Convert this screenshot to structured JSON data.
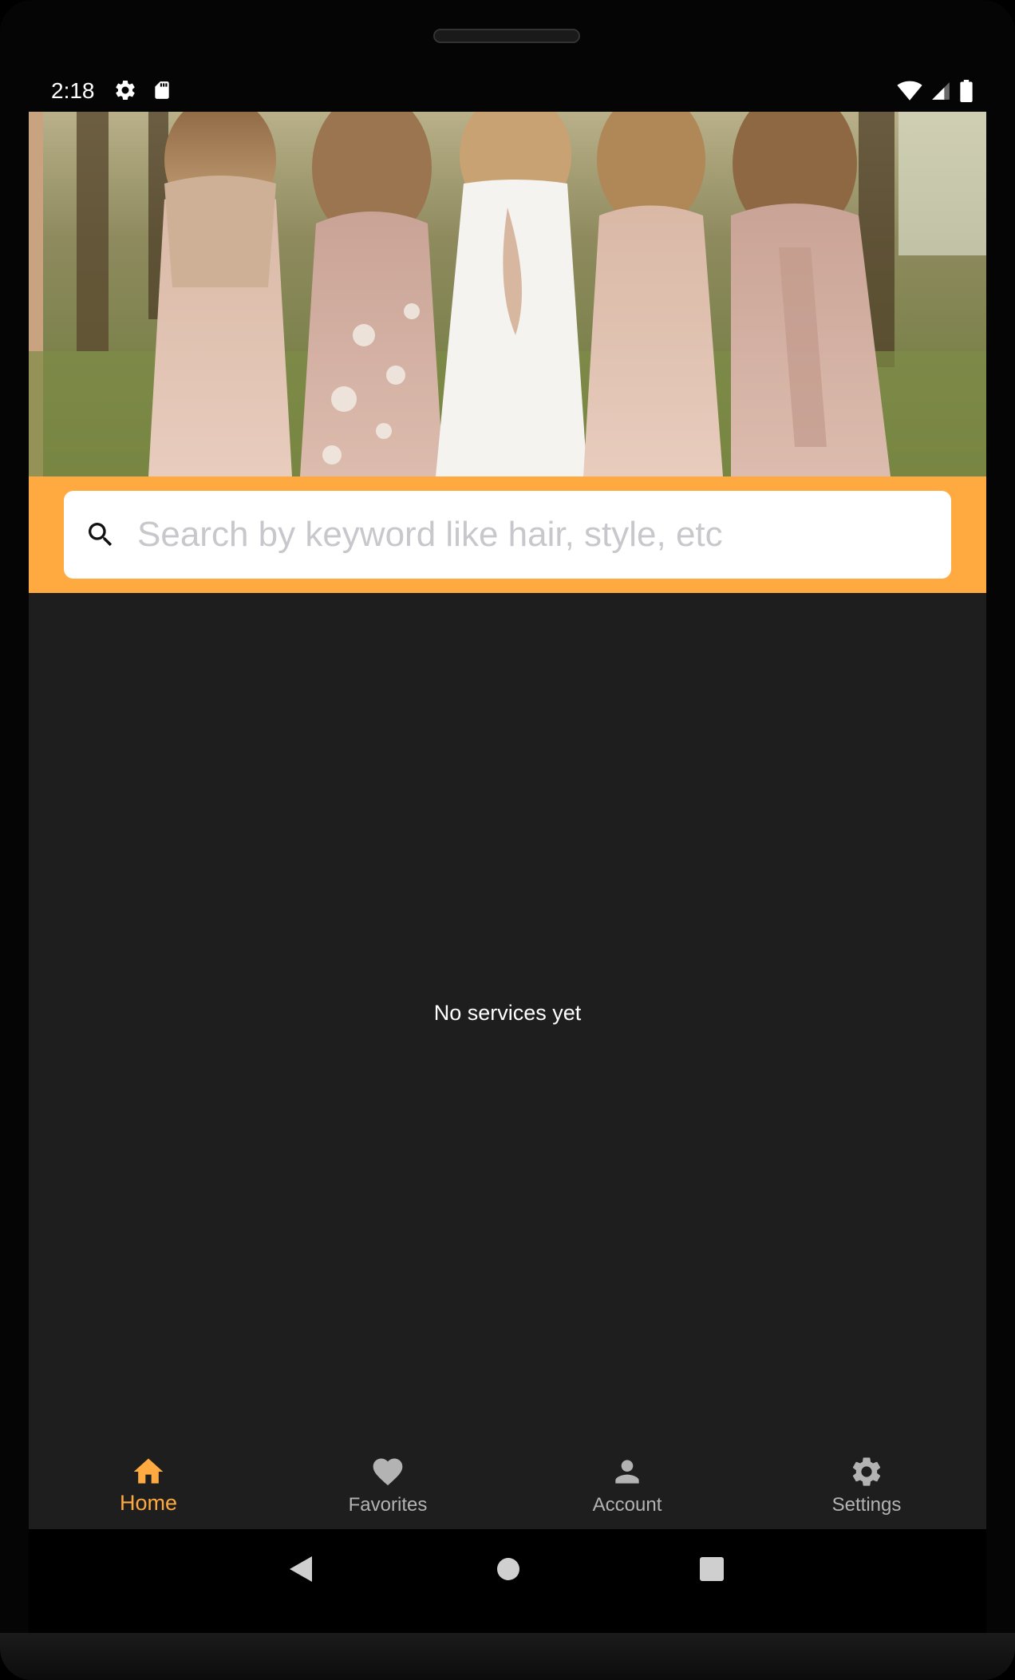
{
  "status_bar": {
    "time": "2:18",
    "left_icons": [
      "gear-icon",
      "sd-card-icon"
    ],
    "right_icons": [
      "wifi-icon",
      "signal-icon",
      "battery-icon"
    ]
  },
  "search": {
    "placeholder": "Search by keyword like hair, style, etc",
    "value": "",
    "band_color": "#ffa941"
  },
  "main": {
    "empty_message": "No services yet"
  },
  "bottom_nav": {
    "items": [
      {
        "label": "Home",
        "icon": "home-icon",
        "active": true
      },
      {
        "label": "Favorites",
        "icon": "heart-icon",
        "active": false
      },
      {
        "label": "Account",
        "icon": "person-icon",
        "active": false
      },
      {
        "label": "Settings",
        "icon": "gear-icon",
        "active": false
      }
    ],
    "active_color": "#ffa941",
    "inactive_color": "#b3b3b3"
  },
  "system_nav": [
    "back-icon",
    "home-circle-icon",
    "recents-icon"
  ]
}
